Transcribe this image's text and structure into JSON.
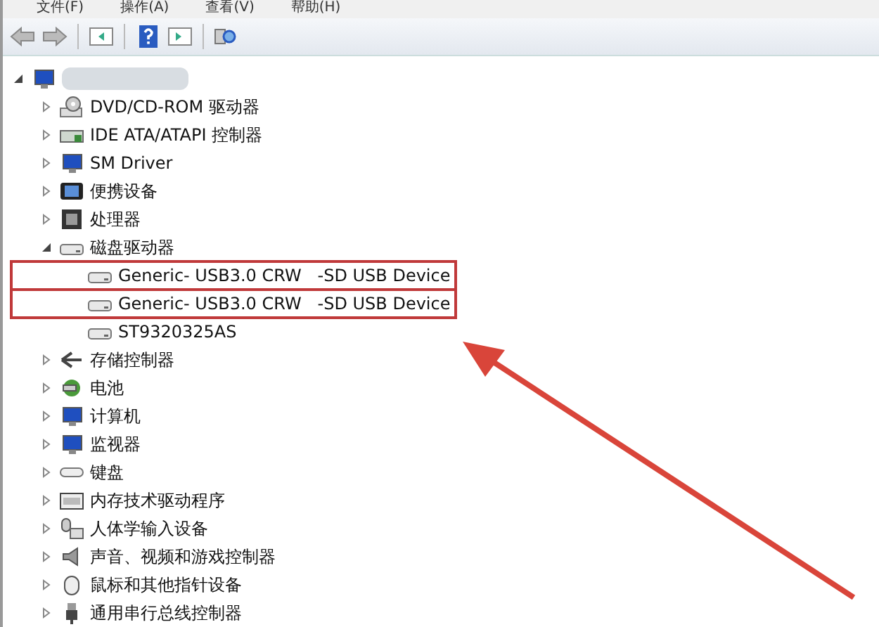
{
  "menu": [
    "文件(F)",
    "操作(A)",
    "查看(V)",
    "帮助(H)"
  ],
  "toolbar": [
    {
      "kind": "back"
    },
    {
      "kind": "forward"
    },
    {
      "kind": "sep"
    },
    {
      "kind": "console"
    },
    {
      "kind": "sep"
    },
    {
      "kind": "help"
    },
    {
      "kind": "panel"
    },
    {
      "kind": "sep"
    },
    {
      "kind": "scan"
    }
  ],
  "tree": {
    "kind": "computer",
    "expanded": true,
    "children": [
      {
        "label": "DVD/CD-ROM 驱动器",
        "kind": "dvd",
        "expanded": false
      },
      {
        "label": "IDE ATA/ATAPI 控制器",
        "kind": "ide",
        "expanded": false
      },
      {
        "label": "SM Driver",
        "kind": "computer",
        "expanded": false
      },
      {
        "label": "便携设备",
        "kind": "portable",
        "expanded": false
      },
      {
        "label": "处理器",
        "kind": "cpu",
        "expanded": false
      },
      {
        "label": "磁盘驱动器",
        "kind": "disk",
        "expanded": true,
        "children": [
          {
            "label": "Generic- USB3.0 CRW   -SD USB Device",
            "kind": "disk",
            "highlighted": true
          },
          {
            "label": "Generic- USB3.0 CRW   -SD USB Device",
            "kind": "disk",
            "highlighted": true
          },
          {
            "label": "ST9320325AS",
            "kind": "disk",
            "highlighted": false
          }
        ]
      },
      {
        "label": "存储控制器",
        "kind": "storage",
        "expanded": false
      },
      {
        "label": "电池",
        "kind": "battery",
        "expanded": false
      },
      {
        "label": "计算机",
        "kind": "computer",
        "expanded": false
      },
      {
        "label": "监视器",
        "kind": "monitor",
        "expanded": false
      },
      {
        "label": "键盘",
        "kind": "keyboard",
        "expanded": false
      },
      {
        "label": "内存技术驱动程序",
        "kind": "memory",
        "expanded": false
      },
      {
        "label": "人体学输入设备",
        "kind": "hid",
        "expanded": false
      },
      {
        "label": "声音、视频和游戏控制器",
        "kind": "sound",
        "expanded": false
      },
      {
        "label": "鼠标和其他指针设备",
        "kind": "mouse",
        "expanded": false
      },
      {
        "label": "通用串行总线控制器",
        "kind": "usb",
        "expanded": false
      }
    ]
  }
}
